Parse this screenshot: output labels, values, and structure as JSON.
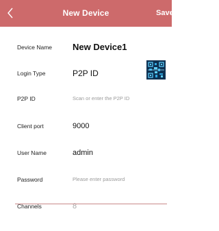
{
  "header": {
    "title": "New Device",
    "save_label": "Save",
    "accent_color": "#cd6a6b"
  },
  "form": {
    "device_name": {
      "label": "Device Name",
      "value": "New Device1"
    },
    "login_type": {
      "label": "Login Type",
      "value": "P2P ID"
    },
    "p2p_id": {
      "label": "P2P ID",
      "placeholder": "Scan or enter the P2P ID"
    },
    "client_port": {
      "label": "Client port",
      "value": "9000"
    },
    "user_name": {
      "label": "User Name",
      "value": "admin"
    },
    "password": {
      "label": "Password",
      "placeholder": "Please enter password"
    },
    "channels": {
      "label": "Channels",
      "value": "8"
    }
  },
  "icons": {
    "back": "chevron-left-icon",
    "login_type_arrow": "chevron-right-icon",
    "scan": "qr-code-icon"
  }
}
